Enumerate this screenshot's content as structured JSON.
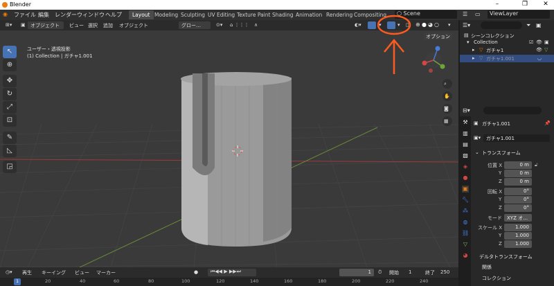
{
  "app": {
    "title": "Blender",
    "window_controls": [
      "–",
      "❐",
      "✕"
    ]
  },
  "menu": [
    "ファイル",
    "編集",
    "レンダー",
    "ウィンドウ",
    "ヘルプ"
  ],
  "workspace_tabs": [
    "Layout",
    "Modeling",
    "Sculpting",
    "UV Editing",
    "Texture Paint",
    "Shading",
    "Animation",
    "Rendering",
    "Compositing"
  ],
  "scene_name": "Scene",
  "view_layer": "ViewLayer",
  "viewport_header": {
    "mode": "オブジェクト",
    "menus": [
      "ビュー",
      "選択",
      "追加",
      "オブジェクト"
    ],
    "orientation": "グロー…",
    "options": "オプション"
  },
  "viewport": {
    "view_name": "ユーザー・透視投影",
    "selection_info": "(1) Collection | ガチャ1.001"
  },
  "outliner": {
    "scene_collection": "シーンコレクション",
    "collection": "Collection",
    "items": [
      "ガチャ1",
      "ガチャ1.001"
    ]
  },
  "properties": {
    "object_name": "ガチャ1.001",
    "data_name": "ガチャ1.001",
    "transform_title": "トランスフォーム",
    "location_label": "位置 X",
    "rotation_label": "回転 X",
    "scale_label": "スケール X",
    "axis_y": "Y",
    "axis_z": "Z",
    "location": [
      "0 m",
      "0 m",
      "0 m"
    ],
    "rotation": [
      "0°",
      "0°",
      "0°"
    ],
    "mode_label": "モード",
    "mode_value": "XYZ オ…",
    "scale": [
      "1.000",
      "1.000",
      "1.000"
    ],
    "delta_transform": "デルタトランスフォーム",
    "relations": "関係",
    "collection_panel": "コレクション"
  },
  "timeline": {
    "menus": [
      "再生",
      "キーイング",
      "ビュー",
      "マーカー"
    ],
    "current_frame": "1",
    "start_label": "開始",
    "start": "1",
    "end_label": "終了",
    "end": "250",
    "ticks": [
      "1",
      "20",
      "40",
      "60",
      "80",
      "100",
      "120",
      "140",
      "160",
      "180",
      "200",
      "220",
      "240"
    ]
  },
  "colors": {
    "annotation": "#ff5a1f",
    "accent": "#4772b3",
    "selected_row": "#334d80"
  }
}
